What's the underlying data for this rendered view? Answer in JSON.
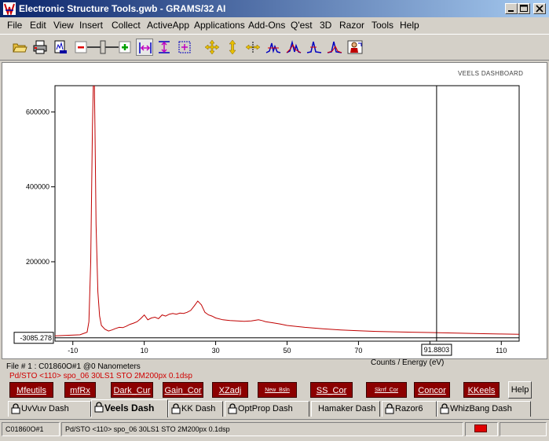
{
  "window": {
    "title": "Electronic Structure Tools.gwb - GRAMS/32 AI"
  },
  "menu": [
    "File",
    "Edit",
    "View",
    "Insert",
    "Collect",
    "ActiveApp",
    "Applications",
    "Add-Ons",
    "Q'est",
    "3D",
    "Razor",
    "Tools",
    "Help"
  ],
  "toolbar": {
    "icons": [
      "open-folder-icon",
      "print-icon",
      "print-preview-icon",
      "zoom-out-icon",
      "zoom-slider",
      "zoom-in-icon",
      "select-x-icon",
      "select-y-icon",
      "select-xy-icon",
      "move-icon",
      "expand-vertical-icon",
      "expand-horizontal-icon",
      "peak-icon",
      "peak-compare-icon",
      "peak-overlay-icon",
      "peak-stack-icon",
      "person-icon"
    ]
  },
  "dashboard_label": "VEELS DASHBOARD",
  "chart_data": {
    "type": "line",
    "xlabel": "Counts / Energy (eV)",
    "xlim": [
      -15,
      115
    ],
    "ylim": [
      -12000,
      670000
    ],
    "x_ticks": [
      -10,
      10,
      30,
      50,
      70,
      90,
      110
    ],
    "y_ticks": [
      200000,
      400000,
      600000
    ],
    "y_cursor_value": "-3085.278",
    "y_cursor": -3085.278,
    "x_cursor_value": "91.8803",
    "x_cursor": 91.8803,
    "color": "#c00000",
    "series": [
      {
        "x": [
          -15,
          -8,
          -6,
          -5.5,
          -5,
          -4.5,
          -4.2,
          -4,
          -3.8,
          -3.5,
          -3,
          -2.5,
          -2,
          -1,
          0,
          1,
          2,
          3,
          4,
          5,
          6,
          7,
          8,
          9,
          10,
          11,
          12,
          13,
          14,
          15,
          16,
          17,
          18,
          19,
          20,
          21,
          22,
          23,
          24,
          25,
          26,
          27,
          28,
          29,
          30,
          32,
          34,
          36,
          38,
          40,
          42,
          43,
          44,
          46,
          48,
          50,
          55,
          60,
          65,
          70,
          75,
          80,
          85,
          90,
          95,
          100,
          105,
          110,
          115
        ],
        "y": [
          2000,
          5000,
          12000,
          40000,
          200000,
          560000,
          700000,
          700000,
          560000,
          300000,
          120000,
          55000,
          30000,
          20000,
          15000,
          18000,
          22000,
          25000,
          24000,
          28000,
          33000,
          36000,
          40000,
          48000,
          58000,
          45000,
          50000,
          52000,
          48000,
          58000,
          55000,
          60000,
          62000,
          60000,
          63000,
          62000,
          65000,
          70000,
          82000,
          95000,
          85000,
          65000,
          58000,
          55000,
          50000,
          45000,
          43000,
          42000,
          41000,
          42000,
          45000,
          43000,
          40000,
          37000,
          34000,
          30000,
          25000,
          21000,
          18000,
          16000,
          14000,
          13000,
          12000,
          11000,
          10000,
          9000,
          8000,
          7000,
          6500
        ]
      }
    ]
  },
  "file_info": {
    "line1": "File # 1 : C01860O#1   @0 Nanometers",
    "line2": "Pd/STO <110> spo_06 30LS1 STO 2M200px 0.1dsp"
  },
  "dash_buttons": [
    {
      "label": "Mfeutils",
      "small": false
    },
    {
      "label": "mfRx",
      "small": false
    },
    {
      "label": "Dark_Cur",
      "small": false
    },
    {
      "label": "Gain_Cor",
      "small": false
    },
    {
      "label": "XZadj",
      "small": false
    },
    {
      "label": "New_Bsln",
      "small": true
    },
    {
      "label": "SS_Cor",
      "small": false
    },
    {
      "label": "Skrrf_Cor",
      "small": true
    },
    {
      "label": "Concor",
      "small": false
    },
    {
      "label": "KKeels",
      "small": false
    }
  ],
  "help_label": "Help",
  "tabs": [
    {
      "label": "UvVuv Dash",
      "lock": true,
      "active": false
    },
    {
      "label": "Veels Dash",
      "lock": true,
      "active": true
    },
    {
      "label": "KK Dash",
      "lock": true,
      "active": false
    },
    {
      "label": "OptProp Dash",
      "lock": true,
      "active": false
    },
    {
      "label": "Hamaker Dash",
      "lock": false,
      "active": false
    },
    {
      "label": "Razor6",
      "lock": true,
      "active": false
    },
    {
      "label": "WhizBang Dash",
      "lock": true,
      "active": false
    }
  ],
  "status": {
    "file": "C01860O#1",
    "desc": "Pd/STO <110> spo_06 30LS1 STO 2M200px 0.1dsp",
    "indicator_color": "#e00000"
  }
}
